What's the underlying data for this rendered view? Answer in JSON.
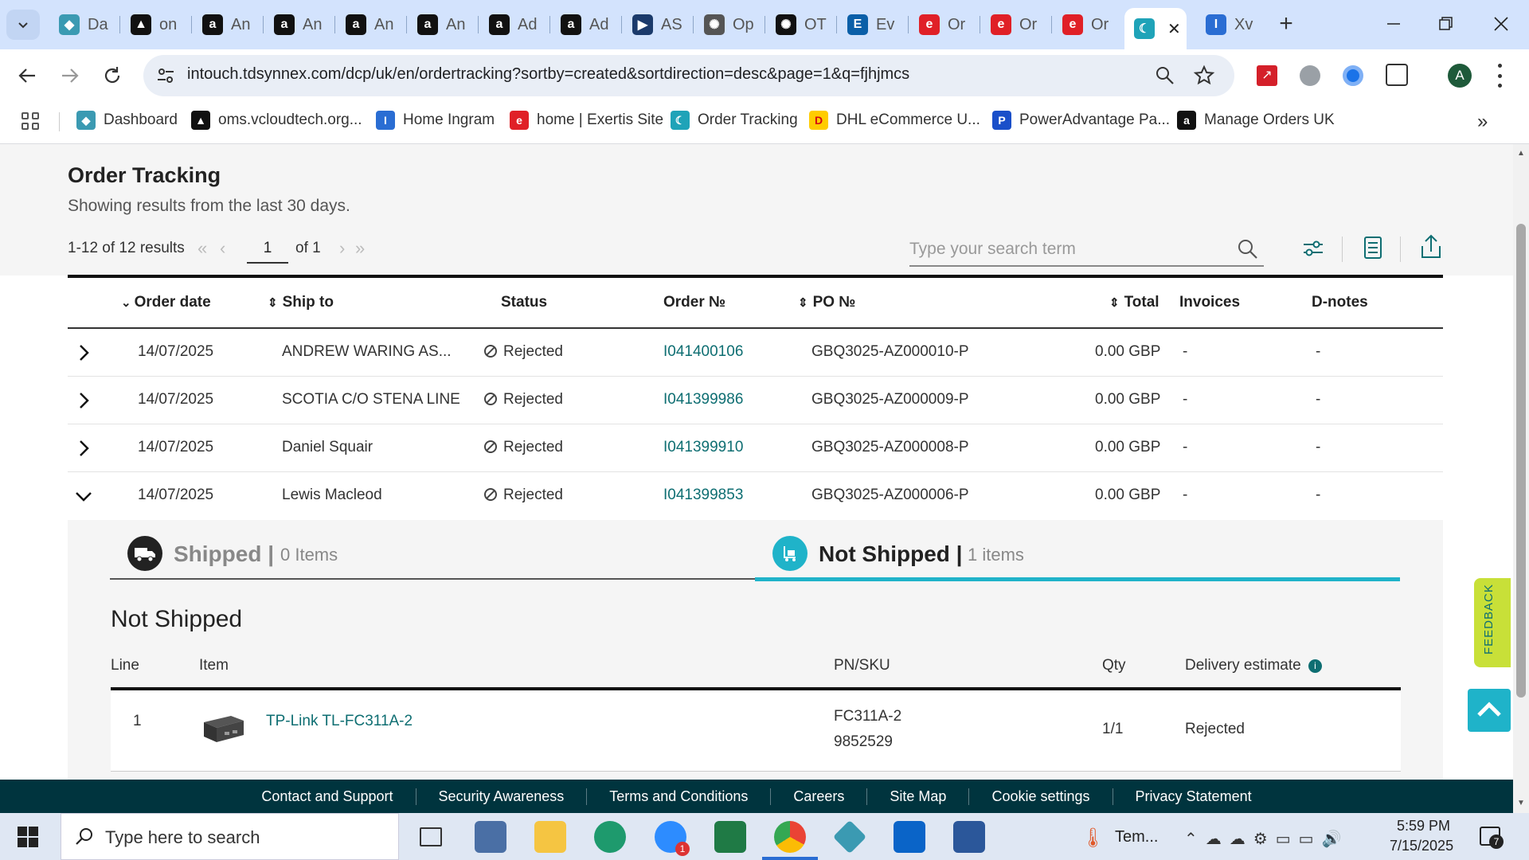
{
  "browser": {
    "tabs": [
      {
        "label": "Da",
        "icon": "tdsynnex-icon",
        "color": "#3b9ab2"
      },
      {
        "label": "on",
        "icon": "vcloud-icon",
        "color": "#111111"
      },
      {
        "label": "An",
        "icon": "amazon-icon",
        "color": "#111111"
      },
      {
        "label": "An",
        "icon": "amazon-icon",
        "color": "#111111"
      },
      {
        "label": "An",
        "icon": "amazon-icon",
        "color": "#111111"
      },
      {
        "label": "An",
        "icon": "amazon-icon",
        "color": "#111111"
      },
      {
        "label": "Ad",
        "icon": "amazon-icon",
        "color": "#111111"
      },
      {
        "label": "Ad",
        "icon": "amazon-icon",
        "color": "#111111"
      },
      {
        "label": "AS",
        "icon": "play-arrow-icon",
        "color": "#1b3a6b"
      },
      {
        "label": "Op",
        "icon": "openai-icon",
        "color": "#555555"
      },
      {
        "label": "OT",
        "icon": "openai-icon",
        "color": "#111111"
      },
      {
        "label": "Ev",
        "icon": "e-icon",
        "color": "#0a5fa8"
      },
      {
        "label": "Or",
        "icon": "exertis-icon",
        "color": "#e02027"
      },
      {
        "label": "Or",
        "icon": "exertis-icon",
        "color": "#e02027"
      },
      {
        "label": "Or",
        "icon": "exertis-icon",
        "color": "#e02027"
      },
      {
        "label": "",
        "icon": "crescent-icon",
        "color": "#1fa3b8",
        "active": true
      },
      {
        "label": "Xv",
        "icon": "ingram-icon",
        "color": "#2a6dd3"
      }
    ],
    "url": "intouch.tdsynnex.com/dcp/uk/en/ordertracking?sortby=created&sortdirection=desc&page=1&q=fjhjmcs",
    "profile_initial": "A",
    "bookmarks": [
      {
        "label": "Dashboard",
        "icon": "tdsynnex-icon",
        "color": "#3b9ab2"
      },
      {
        "label": "oms.vcloudtech.org...",
        "icon": "vcloud-icon",
        "color": "#111111"
      },
      {
        "label": "Home Ingram",
        "icon": "ingram-icon",
        "color": "#2a6dd3"
      },
      {
        "label": "home | Exertis Site",
        "icon": "exertis-icon",
        "color": "#e02027"
      },
      {
        "label": "Order Tracking",
        "icon": "crescent-icon",
        "color": "#1fa3b8"
      },
      {
        "label": "DHL eCommerce U...",
        "icon": "dhl-icon",
        "color": "#ffcc00"
      },
      {
        "label": "PowerAdvantage Pa...",
        "icon": "poweradvantage-icon",
        "color": "#1a4fc9"
      },
      {
        "label": "Manage Orders UK",
        "icon": "amazon-icon",
        "color": "#111111"
      }
    ]
  },
  "page": {
    "title": "Order Tracking",
    "subtitle": "Showing results from the last 30 days.",
    "results": "1-12 of 12 results",
    "page_current": "1",
    "page_of": "of 1",
    "search_placeholder": "Type your search term",
    "columns": [
      "Order date",
      "Ship to",
      "Status",
      "Order №",
      "PO №",
      "Total",
      "Invoices",
      "D-notes"
    ],
    "rows": [
      {
        "date": "14/07/2025",
        "ship_to": "ANDREW WARING AS...",
        "status": "Rejected",
        "order_no": "I041400106",
        "po_no": "GBQ3025-AZ000010-P",
        "total": "0.00 GBP",
        "invoices": "-",
        "dnotes": "-"
      },
      {
        "date": "14/07/2025",
        "ship_to": "SCOTIA C/O STENA LINE",
        "status": "Rejected",
        "order_no": "I041399986",
        "po_no": "GBQ3025-AZ000009-P",
        "total": "0.00 GBP",
        "invoices": "-",
        "dnotes": "-"
      },
      {
        "date": "14/07/2025",
        "ship_to": "Daniel Squair",
        "status": "Rejected",
        "order_no": "I041399910",
        "po_no": "GBQ3025-AZ000008-P",
        "total": "0.00 GBP",
        "invoices": "-",
        "dnotes": "-"
      },
      {
        "date": "14/07/2025",
        "ship_to": "Lewis Macleod",
        "status": "Rejected",
        "order_no": "I041399853",
        "po_no": "GBQ3025-AZ000006-P",
        "total": "0.00 GBP",
        "invoices": "-",
        "dnotes": "-"
      }
    ],
    "detail": {
      "shipped_label": "Shipped |",
      "shipped_count": "0 Items",
      "not_shipped_label": "Not Shipped |",
      "not_shipped_count": "1 items",
      "section_title": "Not Shipped",
      "columns": [
        "Line",
        "Item",
        "PN/SKU",
        "Qty",
        "Delivery estimate"
      ],
      "line": {
        "line": "1",
        "item": "TP-Link TL-FC311A-2",
        "pn": "FC311A-2",
        "sku": "9852529",
        "qty": "1/1",
        "delivery": "Rejected"
      }
    },
    "feedback": "FEEDBACK",
    "footer_links": [
      "Contact and Support",
      "Security Awareness",
      "Terms and Conditions",
      "Careers",
      "Site Map",
      "Cookie settings",
      "Privacy Statement"
    ]
  },
  "taskbar": {
    "search_placeholder": "Type here to search",
    "weather": "Tem...",
    "time": "5:59 PM",
    "date": "7/15/2025",
    "notification_count": "7",
    "zoom_badge": "1"
  },
  "colors": {
    "teal": "#0e6e72",
    "accent": "#1fb3c9",
    "footer": "#00343e",
    "feedback": "#c8e038"
  }
}
